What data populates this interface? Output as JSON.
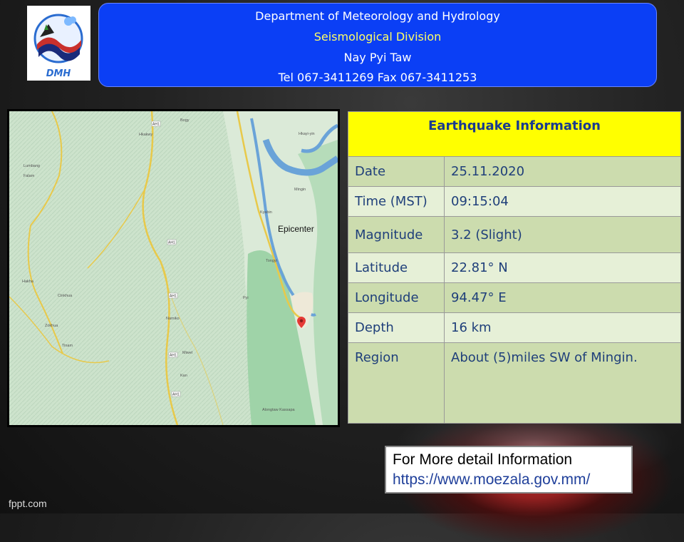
{
  "header": {
    "logo_text": "DMH",
    "line1": "Department of Meteorology and Hydrology",
    "line2": "Seismological Division",
    "line3": "Nay Pyi Taw",
    "line4": "Tel 067-3411269 Fax 067-3411253"
  },
  "map": {
    "epicenter_label": "Epicenter",
    "place_labels": [
      "Bogy",
      "Hkakwy",
      "Lumbang",
      "Falam",
      "Kyabin",
      "Mingin",
      "Tongyi",
      "Hakha",
      "Cinkhua",
      "Zokhua",
      "Tinam",
      "Namiko",
      "Miwel",
      "Kan",
      "Pyi",
      "Alongtaw Kassapa",
      "Hkayi-yin"
    ],
    "road_labels": [
      "AH1",
      "AH1",
      "AH1",
      "AH1",
      "AH1"
    ]
  },
  "table": {
    "title": "Earthquake Information",
    "rows": [
      {
        "key": "Date",
        "value": "25.11.2020"
      },
      {
        "key": "Time (MST)",
        "value": "09:15:04"
      },
      {
        "key": "Magnitude",
        "value": "3.2 (Slight)"
      },
      {
        "key": "Latitude",
        "value": "22.81° N"
      },
      {
        "key": "Longitude",
        "value": "94.47° E"
      },
      {
        "key": "Depth",
        "value": "16 km"
      },
      {
        "key": "Region",
        "value": "About (5)miles SW of Mingin."
      }
    ]
  },
  "more_info": {
    "line1": "For More detail Information",
    "url": "https://www.moezala.gov.mm/"
  },
  "footer": {
    "watermark": "fppt.com"
  },
  "colors": {
    "header_bg": "#0b3ff5",
    "table_head_bg": "#ffff00",
    "table_row_dark": "#ccdcae",
    "table_row_light": "#e6f0d7",
    "table_text": "#1f3f7a"
  }
}
